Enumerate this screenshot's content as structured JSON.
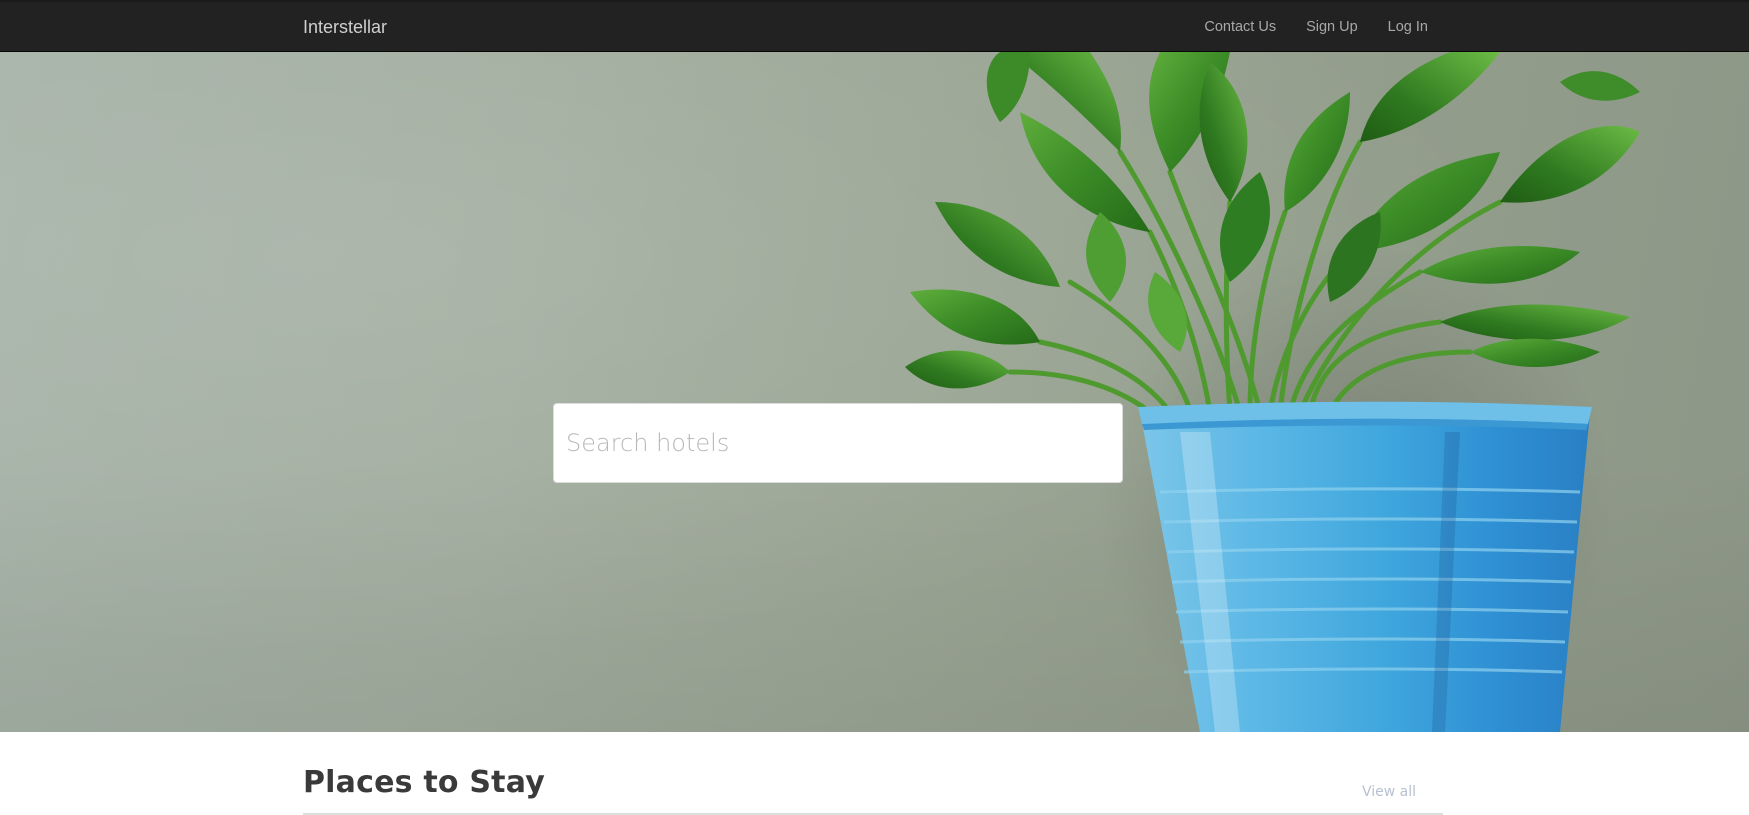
{
  "navbar": {
    "brand": "Interstellar",
    "links": [
      "Contact Us",
      "Sign Up",
      "Log In"
    ]
  },
  "hero": {
    "search_placeholder": "Search hotels"
  },
  "places": {
    "title": "Places to Stay",
    "view_all_label": "View all"
  },
  "colors": {
    "navbar_bg": "#222222",
    "navbar_text": "#a8a8a8",
    "pot_blue": "#4fb3e0",
    "leaf_green": "#3e8e2a",
    "wall_gray_green": "#9ea894"
  },
  "icons": {
    "hero_image": "potted-plant-photo"
  }
}
